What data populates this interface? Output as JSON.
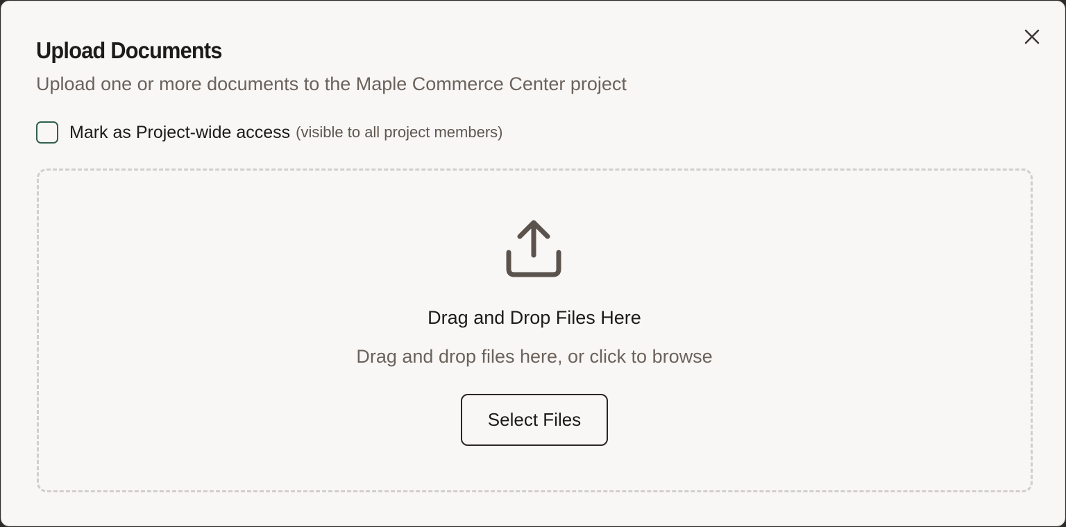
{
  "dialog": {
    "title": "Upload Documents",
    "subtitle": "Upload one or more documents to the Maple Commerce Center project",
    "close_icon": "close-icon"
  },
  "access": {
    "label": "Mark as Project-wide access",
    "hint": "(visible to all project members)",
    "checked": false
  },
  "dropzone": {
    "icon": "upload-icon",
    "title": "Drag and Drop Files Here",
    "hint": "Drag and drop files here, or click to browse",
    "button_label": "Select Files"
  },
  "colors": {
    "background": "#f8f7f5",
    "text_primary": "#1d1b19",
    "text_secondary": "#6b625c",
    "checkbox_border": "#2f5f4d",
    "dashed_border": "#d1cecb",
    "icon": "#5a524d"
  }
}
